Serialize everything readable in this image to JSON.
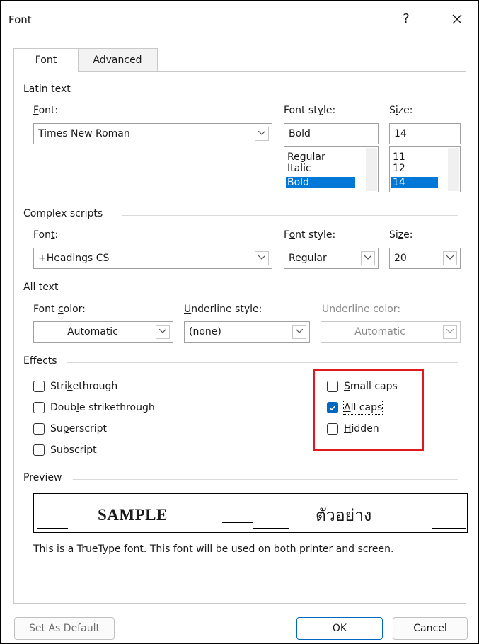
{
  "window": {
    "title": "Font",
    "help_label": "?",
    "close_label": "✕"
  },
  "tabs": [
    {
      "label": "Font",
      "active": true
    },
    {
      "label": "Advanced",
      "active": false
    }
  ],
  "latin": {
    "section_label": "Latin text",
    "font_label": "Font:",
    "font_value": "Times New Roman",
    "style_label": "Font style:",
    "style_value": "Bold",
    "style_options": [
      "Regular",
      "Italic",
      "Bold"
    ],
    "size_label": "Size:",
    "size_value": "14",
    "size_options": [
      "11",
      "12",
      "14"
    ]
  },
  "complex": {
    "section_label": "Complex scripts",
    "font_label": "Font:",
    "font_value": "+Headings CS",
    "style_label": "Font style:",
    "style_value": "Regular",
    "size_label": "Size:",
    "size_value": "20"
  },
  "alltext": {
    "section_label": "All text",
    "color_label": "Font color:",
    "color_value": "Automatic",
    "underline_label": "Underline style:",
    "underline_value": "(none)",
    "underline_color_label": "Underline color:",
    "underline_color_value": "Automatic"
  },
  "effects": {
    "section_label": "Effects",
    "strikethrough": {
      "label": "Strikethrough",
      "checked": false
    },
    "double_strikethrough": {
      "label": "Double strikethrough",
      "checked": false
    },
    "superscript": {
      "label": "Superscript",
      "checked": false
    },
    "subscript": {
      "label": "Subscript",
      "checked": false
    },
    "small_caps": {
      "label": "Small caps",
      "checked": false
    },
    "all_caps": {
      "label": "All caps",
      "checked": true
    },
    "hidden": {
      "label": "Hidden",
      "checked": false
    }
  },
  "preview": {
    "section_label": "Preview",
    "sample_text": "SAMPLE",
    "complex_sample": "ตัวอย่าง",
    "note": "This is a TrueType font. This font will be used on both printer and screen."
  },
  "buttons": {
    "set_default": "Set As Default",
    "ok": "OK",
    "cancel": "Cancel"
  },
  "colors": {
    "accent": "#0078d7",
    "highlight_box": "#e0191f"
  }
}
